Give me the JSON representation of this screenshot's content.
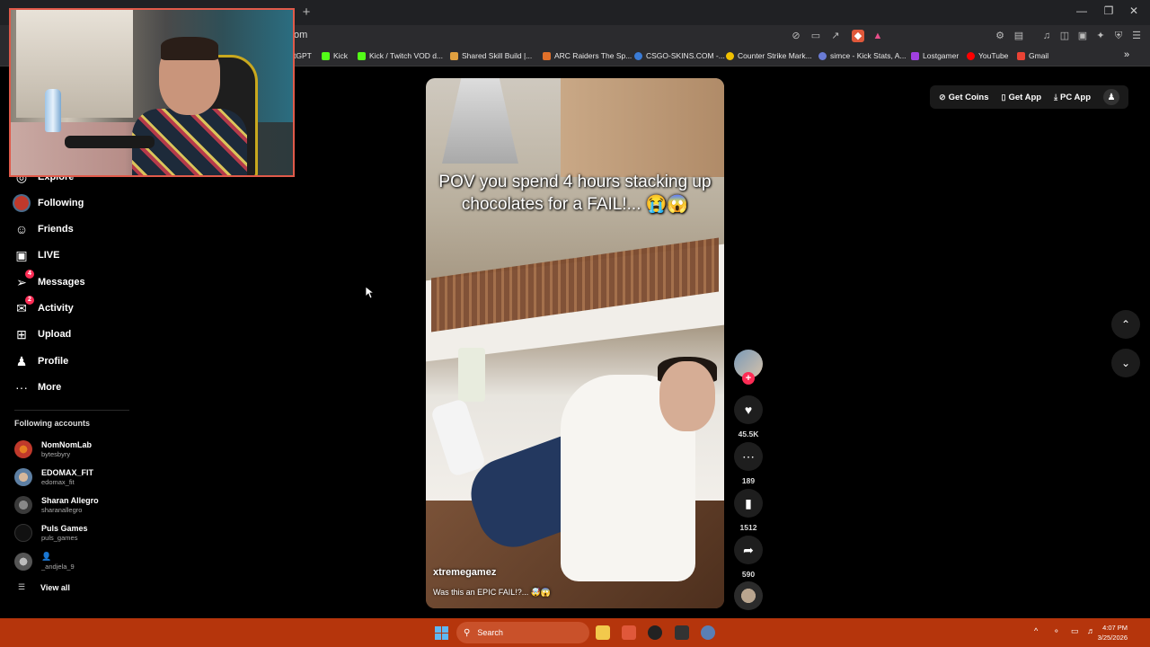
{
  "browser": {
    "url_fragment": "om",
    "new_tab_label": "+",
    "window_controls": [
      "—",
      "❐",
      "✕"
    ],
    "bookmarks": [
      {
        "label": "tGPT",
        "color": "#74aa9c"
      },
      {
        "label": "Kick",
        "color": "#53fc18"
      },
      {
        "label": "Kick / Twitch VOD d...",
        "color": "#53fc18"
      },
      {
        "label": "Shared Skill Build |...",
        "color": "#e0a040"
      },
      {
        "label": "ARC Raiders The Sp...",
        "color": "#e0702a"
      },
      {
        "label": "CSGO-SKINS.COM -...",
        "color": "#3a7bd5"
      },
      {
        "label": "Counter Strike Mark...",
        "color": "#f0c000"
      },
      {
        "label": "simce - Kick Stats, A...",
        "color": "#6a7bd5"
      },
      {
        "label": "Lostgamer",
        "color": "#a040e0"
      },
      {
        "label": "YouTube",
        "color": "#ff0000"
      },
      {
        "label": "Gmail",
        "color": "#ea4335"
      }
    ],
    "bookmarks_overflow": "»"
  },
  "sidebar": {
    "nav": [
      {
        "label": "Explore",
        "icon": "compass-icon",
        "glyph": "◎",
        "badge": ""
      },
      {
        "label": "Following",
        "icon": "avatar-icon",
        "glyph": "●",
        "badge": ""
      },
      {
        "label": "Friends",
        "icon": "people-icon",
        "glyph": "☺",
        "badge": ""
      },
      {
        "label": "LIVE",
        "icon": "live-icon",
        "glyph": "▣",
        "badge": ""
      },
      {
        "label": "Messages",
        "icon": "send-icon",
        "glyph": "➢",
        "badge": "4"
      },
      {
        "label": "Activity",
        "icon": "inbox-icon",
        "glyph": "✉",
        "badge": "2"
      },
      {
        "label": "Upload",
        "icon": "plus-square-icon",
        "glyph": "⊞",
        "badge": ""
      },
      {
        "label": "Profile",
        "icon": "profile-icon",
        "glyph": "♟",
        "badge": ""
      },
      {
        "label": "More",
        "icon": "more-icon",
        "glyph": "···",
        "badge": ""
      }
    ],
    "following_header": "Following accounts",
    "accounts": [
      {
        "name": "NomNomLab",
        "handle": "bytesbyry",
        "color": "#c0392b"
      },
      {
        "name": "EDOMAX_FIT",
        "handle": "edomax_fit",
        "color": "#5d7fa3"
      },
      {
        "name": "Sharan Allegro",
        "handle": "sharanallegro",
        "color": "#4a4a4a"
      },
      {
        "name": "Puls Games",
        "handle": "puls_games",
        "color": "#111111"
      },
      {
        "name": "👤",
        "handle": "_andjela_9",
        "color": "#777777"
      }
    ],
    "view_all": "View all"
  },
  "header": {
    "get_coins": "Get Coins",
    "get_app": "Get App",
    "pc_app": "PC App"
  },
  "video": {
    "caption": "POV you spend 4 hours stacking up chocolates for a FAIL!... 😭😱",
    "author": "xtremegamez",
    "description": "Was this an EPIC FAIL!?... 🤯😱"
  },
  "actions": {
    "likes": "45.5K",
    "comments": "189",
    "saves": "1512",
    "shares": "590",
    "follow_plus": "+"
  },
  "taskbar": {
    "search": "Search",
    "time": "4:07 PM",
    "date": "3/25/2026",
    "tray_chevron": "^"
  },
  "colors": {
    "accent": "#fe2c55",
    "taskbar": "#b5350c",
    "webcam_border": "#e05a4a"
  }
}
